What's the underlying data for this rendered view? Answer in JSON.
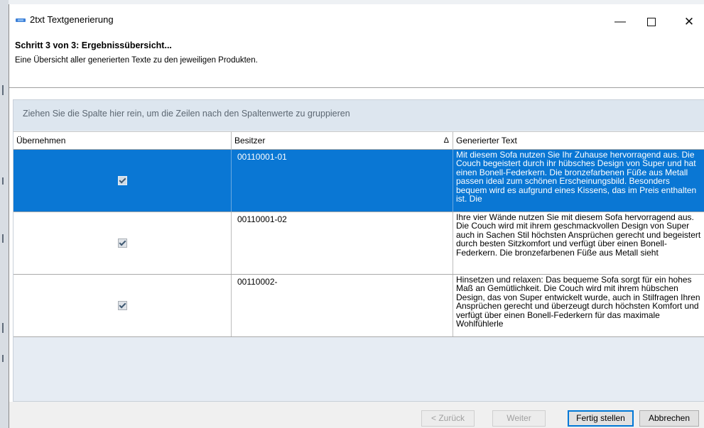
{
  "window": {
    "title": "2txt Textgenerierung",
    "minimize_glyph": "—",
    "close_glyph": "✕"
  },
  "step": {
    "title": "Schritt 3 von 3: Ergebnissübersicht...",
    "description": "Eine Übersicht aller generierten Texte zu den jeweiligen Produkten."
  },
  "grid": {
    "group_hint": "Ziehen Sie die Spalte hier rein, um die Zeilen nach den Spaltenwerte zu gruppieren",
    "columns": [
      "Übernehmen",
      "Besitzer",
      "Generierter Text"
    ],
    "sort_indicator": "Δ",
    "rows": [
      {
        "checked": true,
        "owner": "00110001-01",
        "text": "Mit diesem Sofa nutzen Sie Ihr Zuhause hervorragend aus. Die Couch begeistert durch ihr hübsches Design von Super und hat einen Bonell-Federkern. Die bronzefarbenen Füße aus Metall passen ideal zum schönen Erscheinungsbild. Besonders bequem wird es aufgrund eines Kissens, das im Preis enthalten ist. Die",
        "selected": true
      },
      {
        "checked": true,
        "owner": "00110001-02",
        "text": "Ihre vier Wände nutzen Sie mit diesem Sofa hervorragend aus. Die Couch wird mit ihrem geschmackvollen Design von Super auch in Sachen Stil höchsten Ansprüchen gerecht und begeistert durch besten Sitzkomfort und verfügt über einen Bonell-Federkern. Die bronzefarbenen Füße aus Metall sieht",
        "selected": false
      },
      {
        "checked": true,
        "owner": "00110002-",
        "text": "Hinsetzen und relaxen: Das bequeme Sofa sorgt für ein hohes Maß an Gemütlichkeit. Die Couch wird mit ihrem hübschen Design, das von Super entwickelt wurde, auch in Stilfragen Ihren Ansprüchen gerecht und überzeugt durch höchsten Komfort und verfügt über einen Bonell-Federkern für das maximale Wohlfühlerle",
        "selected": false
      }
    ]
  },
  "buttons": {
    "back": "< Zurück",
    "next": "Weiter",
    "finish": "Fertig stellen",
    "cancel": "Abbrechen"
  },
  "colors": {
    "selection": "#0a77d4",
    "group_panel": "#dde6ef",
    "default_button_border": "#0078d7"
  }
}
